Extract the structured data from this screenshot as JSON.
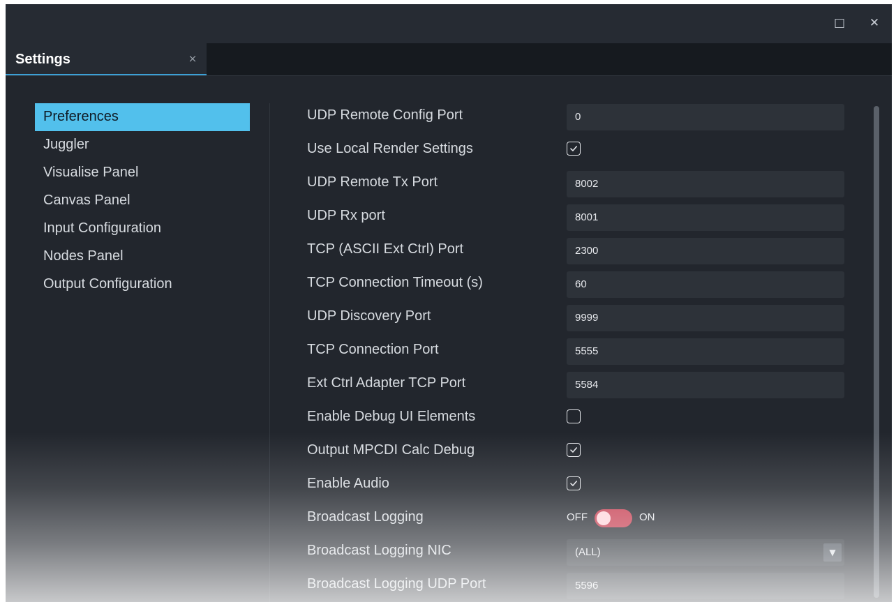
{
  "window": {
    "maximize_icon": "□",
    "close_icon": "✕"
  },
  "tab": {
    "label": "Settings",
    "close_icon": "×"
  },
  "sidebar": {
    "items": [
      {
        "label": "Preferences",
        "active": true
      },
      {
        "label": "Juggler"
      },
      {
        "label": "Visualise Panel"
      },
      {
        "label": "Canvas Panel"
      },
      {
        "label": "Input Configuration"
      },
      {
        "label": "Nodes Panel"
      },
      {
        "label": "Output Configuration"
      }
    ]
  },
  "preferences": {
    "udp_remote_config_port": {
      "label": "UDP Remote Config Port",
      "value": "0"
    },
    "use_local_render_settings": {
      "label": "Use Local Render Settings",
      "checked": true
    },
    "udp_remote_tx_port": {
      "label": "UDP Remote Tx Port",
      "value": "8002"
    },
    "udp_rx_port": {
      "label": "UDP Rx port",
      "value": "8001"
    },
    "tcp_ascii_ext_ctrl_port": {
      "label": "TCP (ASCII Ext Ctrl) Port",
      "value": "2300"
    },
    "tcp_connection_timeout": {
      "label": "TCP Connection Timeout (s)",
      "value": "60"
    },
    "udp_discovery_port": {
      "label": "UDP Discovery Port",
      "value": "9999"
    },
    "tcp_connection_port": {
      "label": "TCP Connection Port",
      "value": "5555"
    },
    "ext_ctrl_adapter_tcp_port": {
      "label": "Ext Ctrl Adapter TCP Port",
      "value": "5584"
    },
    "enable_debug_ui_elements": {
      "label": "Enable Debug UI Elements",
      "checked": false
    },
    "output_mpcdi_calc_debug": {
      "label": "Output MPCDI Calc Debug",
      "checked": true
    },
    "enable_audio": {
      "label": "Enable Audio",
      "checked": true
    },
    "broadcast_logging": {
      "label": "Broadcast Logging",
      "off_label": "OFF",
      "on_label": "ON",
      "state": "OFF"
    },
    "broadcast_logging_nic": {
      "label": "Broadcast Logging NIC",
      "value": "(ALL)",
      "caret": "▼"
    },
    "broadcast_logging_udp_port": {
      "label": "Broadcast Logging UDP Port",
      "value": "5596"
    }
  },
  "colors": {
    "accent": "#52c0ec",
    "tab_underline": "#3ca0d6",
    "toggle_off": "#c63d50",
    "background": "#22262d"
  }
}
